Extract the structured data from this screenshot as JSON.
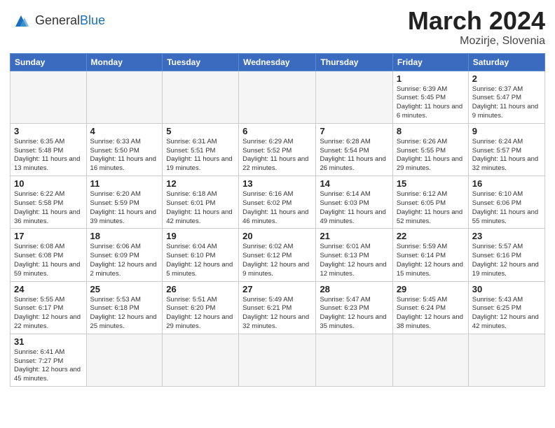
{
  "header": {
    "logo_general": "General",
    "logo_blue": "Blue",
    "title": "March 2024",
    "subtitle": "Mozirje, Slovenia"
  },
  "weekdays": [
    "Sunday",
    "Monday",
    "Tuesday",
    "Wednesday",
    "Thursday",
    "Friday",
    "Saturday"
  ],
  "weeks": [
    [
      {
        "day": "",
        "info": ""
      },
      {
        "day": "",
        "info": ""
      },
      {
        "day": "",
        "info": ""
      },
      {
        "day": "",
        "info": ""
      },
      {
        "day": "",
        "info": ""
      },
      {
        "day": "1",
        "info": "Sunrise: 6:39 AM\nSunset: 5:45 PM\nDaylight: 11 hours and 6 minutes."
      },
      {
        "day": "2",
        "info": "Sunrise: 6:37 AM\nSunset: 5:47 PM\nDaylight: 11 hours and 9 minutes."
      }
    ],
    [
      {
        "day": "3",
        "info": "Sunrise: 6:35 AM\nSunset: 5:48 PM\nDaylight: 11 hours and 13 minutes."
      },
      {
        "day": "4",
        "info": "Sunrise: 6:33 AM\nSunset: 5:50 PM\nDaylight: 11 hours and 16 minutes."
      },
      {
        "day": "5",
        "info": "Sunrise: 6:31 AM\nSunset: 5:51 PM\nDaylight: 11 hours and 19 minutes."
      },
      {
        "day": "6",
        "info": "Sunrise: 6:29 AM\nSunset: 5:52 PM\nDaylight: 11 hours and 22 minutes."
      },
      {
        "day": "7",
        "info": "Sunrise: 6:28 AM\nSunset: 5:54 PM\nDaylight: 11 hours and 26 minutes."
      },
      {
        "day": "8",
        "info": "Sunrise: 6:26 AM\nSunset: 5:55 PM\nDaylight: 11 hours and 29 minutes."
      },
      {
        "day": "9",
        "info": "Sunrise: 6:24 AM\nSunset: 5:57 PM\nDaylight: 11 hours and 32 minutes."
      }
    ],
    [
      {
        "day": "10",
        "info": "Sunrise: 6:22 AM\nSunset: 5:58 PM\nDaylight: 11 hours and 36 minutes."
      },
      {
        "day": "11",
        "info": "Sunrise: 6:20 AM\nSunset: 5:59 PM\nDaylight: 11 hours and 39 minutes."
      },
      {
        "day": "12",
        "info": "Sunrise: 6:18 AM\nSunset: 6:01 PM\nDaylight: 11 hours and 42 minutes."
      },
      {
        "day": "13",
        "info": "Sunrise: 6:16 AM\nSunset: 6:02 PM\nDaylight: 11 hours and 46 minutes."
      },
      {
        "day": "14",
        "info": "Sunrise: 6:14 AM\nSunset: 6:03 PM\nDaylight: 11 hours and 49 minutes."
      },
      {
        "day": "15",
        "info": "Sunrise: 6:12 AM\nSunset: 6:05 PM\nDaylight: 11 hours and 52 minutes."
      },
      {
        "day": "16",
        "info": "Sunrise: 6:10 AM\nSunset: 6:06 PM\nDaylight: 11 hours and 55 minutes."
      }
    ],
    [
      {
        "day": "17",
        "info": "Sunrise: 6:08 AM\nSunset: 6:08 PM\nDaylight: 11 hours and 59 minutes."
      },
      {
        "day": "18",
        "info": "Sunrise: 6:06 AM\nSunset: 6:09 PM\nDaylight: 12 hours and 2 minutes."
      },
      {
        "day": "19",
        "info": "Sunrise: 6:04 AM\nSunset: 6:10 PM\nDaylight: 12 hours and 5 minutes."
      },
      {
        "day": "20",
        "info": "Sunrise: 6:02 AM\nSunset: 6:12 PM\nDaylight: 12 hours and 9 minutes."
      },
      {
        "day": "21",
        "info": "Sunrise: 6:01 AM\nSunset: 6:13 PM\nDaylight: 12 hours and 12 minutes."
      },
      {
        "day": "22",
        "info": "Sunrise: 5:59 AM\nSunset: 6:14 PM\nDaylight: 12 hours and 15 minutes."
      },
      {
        "day": "23",
        "info": "Sunrise: 5:57 AM\nSunset: 6:16 PM\nDaylight: 12 hours and 19 minutes."
      }
    ],
    [
      {
        "day": "24",
        "info": "Sunrise: 5:55 AM\nSunset: 6:17 PM\nDaylight: 12 hours and 22 minutes."
      },
      {
        "day": "25",
        "info": "Sunrise: 5:53 AM\nSunset: 6:18 PM\nDaylight: 12 hours and 25 minutes."
      },
      {
        "day": "26",
        "info": "Sunrise: 5:51 AM\nSunset: 6:20 PM\nDaylight: 12 hours and 29 minutes."
      },
      {
        "day": "27",
        "info": "Sunrise: 5:49 AM\nSunset: 6:21 PM\nDaylight: 12 hours and 32 minutes."
      },
      {
        "day": "28",
        "info": "Sunrise: 5:47 AM\nSunset: 6:23 PM\nDaylight: 12 hours and 35 minutes."
      },
      {
        "day": "29",
        "info": "Sunrise: 5:45 AM\nSunset: 6:24 PM\nDaylight: 12 hours and 38 minutes."
      },
      {
        "day": "30",
        "info": "Sunrise: 5:43 AM\nSunset: 6:25 PM\nDaylight: 12 hours and 42 minutes."
      }
    ],
    [
      {
        "day": "31",
        "info": "Sunrise: 6:41 AM\nSunset: 7:27 PM\nDaylight: 12 hours and 45 minutes."
      },
      {
        "day": "",
        "info": ""
      },
      {
        "day": "",
        "info": ""
      },
      {
        "day": "",
        "info": ""
      },
      {
        "day": "",
        "info": ""
      },
      {
        "day": "",
        "info": ""
      },
      {
        "day": "",
        "info": ""
      }
    ]
  ]
}
